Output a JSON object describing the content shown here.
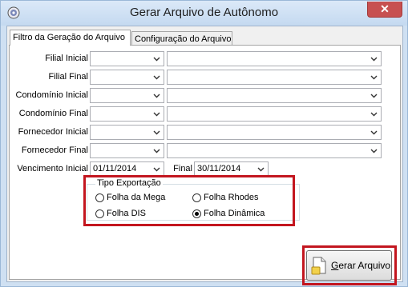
{
  "window": {
    "title": "Gerar Arquivo de Autônomo",
    "close_glyph": "✕"
  },
  "tabs": [
    {
      "label": "Filtro da Geração do Arquivo",
      "active": true
    },
    {
      "label": "Configuração do Arquivo",
      "active": false
    }
  ],
  "filters": {
    "filial_inicial": "Filial Inicial",
    "filial_final": "Filial Final",
    "condominio_inicial": "Condomínio Inicial",
    "condominio_final": "Condomínio Final",
    "fornecedor_inicial": "Fornecedor Inicial",
    "fornecedor_final": "Fornecedor Final",
    "vencimento_inicial_label": "Vencimento Inicial",
    "vencimento_inicial_value": "01/11/2014",
    "final_label": "Final",
    "final_value": "30/11/2014"
  },
  "tipo_exportacao": {
    "title": "Tipo Exportação",
    "options": [
      {
        "label": "Folha da Mega",
        "selected": false
      },
      {
        "label": "Folha Rhodes",
        "selected": false
      },
      {
        "label": "Folha DIS",
        "selected": false
      },
      {
        "label": "Folha Dinâmica",
        "selected": true
      }
    ]
  },
  "actions": {
    "gerar_prefix": "G",
    "gerar_rest": "erar Arquivo"
  },
  "icons": {
    "app": "app-icon",
    "close": "close-icon",
    "chevron": "chevron-down-icon",
    "file": "document-icon"
  },
  "colors": {
    "highlight": "#c3161f",
    "close": "#c75050"
  }
}
